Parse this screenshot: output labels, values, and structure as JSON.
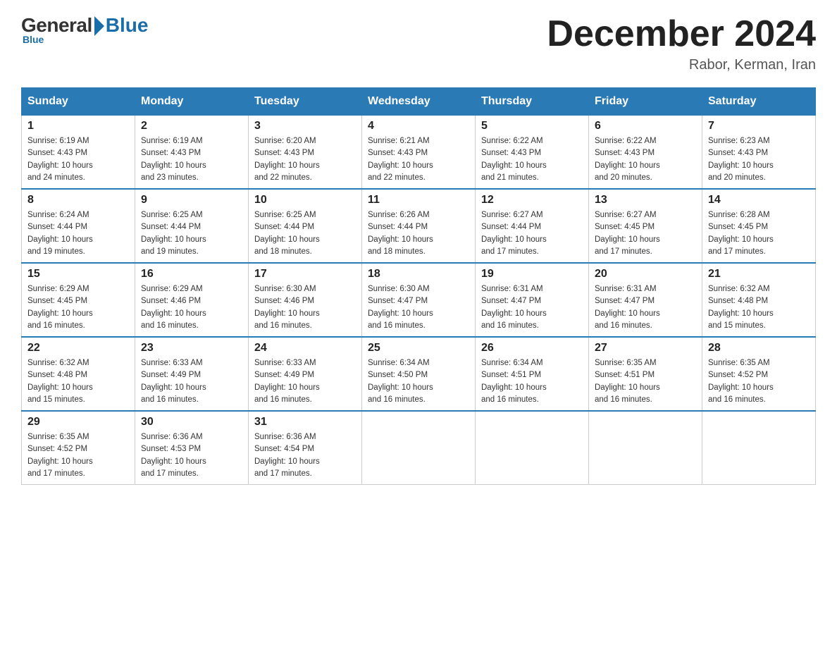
{
  "header": {
    "logo_general": "General",
    "logo_blue": "Blue",
    "month_year": "December 2024",
    "location": "Rabor, Kerman, Iran"
  },
  "days_of_week": [
    "Sunday",
    "Monday",
    "Tuesday",
    "Wednesday",
    "Thursday",
    "Friday",
    "Saturday"
  ],
  "weeks": [
    [
      {
        "day": "1",
        "sunrise": "6:19 AM",
        "sunset": "4:43 PM",
        "daylight": "10 hours and 24 minutes."
      },
      {
        "day": "2",
        "sunrise": "6:19 AM",
        "sunset": "4:43 PM",
        "daylight": "10 hours and 23 minutes."
      },
      {
        "day": "3",
        "sunrise": "6:20 AM",
        "sunset": "4:43 PM",
        "daylight": "10 hours and 22 minutes."
      },
      {
        "day": "4",
        "sunrise": "6:21 AM",
        "sunset": "4:43 PM",
        "daylight": "10 hours and 22 minutes."
      },
      {
        "day": "5",
        "sunrise": "6:22 AM",
        "sunset": "4:43 PM",
        "daylight": "10 hours and 21 minutes."
      },
      {
        "day": "6",
        "sunrise": "6:22 AM",
        "sunset": "4:43 PM",
        "daylight": "10 hours and 20 minutes."
      },
      {
        "day": "7",
        "sunrise": "6:23 AM",
        "sunset": "4:43 PM",
        "daylight": "10 hours and 20 minutes."
      }
    ],
    [
      {
        "day": "8",
        "sunrise": "6:24 AM",
        "sunset": "4:44 PM",
        "daylight": "10 hours and 19 minutes."
      },
      {
        "day": "9",
        "sunrise": "6:25 AM",
        "sunset": "4:44 PM",
        "daylight": "10 hours and 19 minutes."
      },
      {
        "day": "10",
        "sunrise": "6:25 AM",
        "sunset": "4:44 PM",
        "daylight": "10 hours and 18 minutes."
      },
      {
        "day": "11",
        "sunrise": "6:26 AM",
        "sunset": "4:44 PM",
        "daylight": "10 hours and 18 minutes."
      },
      {
        "day": "12",
        "sunrise": "6:27 AM",
        "sunset": "4:44 PM",
        "daylight": "10 hours and 17 minutes."
      },
      {
        "day": "13",
        "sunrise": "6:27 AM",
        "sunset": "4:45 PM",
        "daylight": "10 hours and 17 minutes."
      },
      {
        "day": "14",
        "sunrise": "6:28 AM",
        "sunset": "4:45 PM",
        "daylight": "10 hours and 17 minutes."
      }
    ],
    [
      {
        "day": "15",
        "sunrise": "6:29 AM",
        "sunset": "4:45 PM",
        "daylight": "10 hours and 16 minutes."
      },
      {
        "day": "16",
        "sunrise": "6:29 AM",
        "sunset": "4:46 PM",
        "daylight": "10 hours and 16 minutes."
      },
      {
        "day": "17",
        "sunrise": "6:30 AM",
        "sunset": "4:46 PM",
        "daylight": "10 hours and 16 minutes."
      },
      {
        "day": "18",
        "sunrise": "6:30 AM",
        "sunset": "4:47 PM",
        "daylight": "10 hours and 16 minutes."
      },
      {
        "day": "19",
        "sunrise": "6:31 AM",
        "sunset": "4:47 PM",
        "daylight": "10 hours and 16 minutes."
      },
      {
        "day": "20",
        "sunrise": "6:31 AM",
        "sunset": "4:47 PM",
        "daylight": "10 hours and 16 minutes."
      },
      {
        "day": "21",
        "sunrise": "6:32 AM",
        "sunset": "4:48 PM",
        "daylight": "10 hours and 15 minutes."
      }
    ],
    [
      {
        "day": "22",
        "sunrise": "6:32 AM",
        "sunset": "4:48 PM",
        "daylight": "10 hours and 15 minutes."
      },
      {
        "day": "23",
        "sunrise": "6:33 AM",
        "sunset": "4:49 PM",
        "daylight": "10 hours and 16 minutes."
      },
      {
        "day": "24",
        "sunrise": "6:33 AM",
        "sunset": "4:49 PM",
        "daylight": "10 hours and 16 minutes."
      },
      {
        "day": "25",
        "sunrise": "6:34 AM",
        "sunset": "4:50 PM",
        "daylight": "10 hours and 16 minutes."
      },
      {
        "day": "26",
        "sunrise": "6:34 AM",
        "sunset": "4:51 PM",
        "daylight": "10 hours and 16 minutes."
      },
      {
        "day": "27",
        "sunrise": "6:35 AM",
        "sunset": "4:51 PM",
        "daylight": "10 hours and 16 minutes."
      },
      {
        "day": "28",
        "sunrise": "6:35 AM",
        "sunset": "4:52 PM",
        "daylight": "10 hours and 16 minutes."
      }
    ],
    [
      {
        "day": "29",
        "sunrise": "6:35 AM",
        "sunset": "4:52 PM",
        "daylight": "10 hours and 17 minutes."
      },
      {
        "day": "30",
        "sunrise": "6:36 AM",
        "sunset": "4:53 PM",
        "daylight": "10 hours and 17 minutes."
      },
      {
        "day": "31",
        "sunrise": "6:36 AM",
        "sunset": "4:54 PM",
        "daylight": "10 hours and 17 minutes."
      },
      null,
      null,
      null,
      null
    ]
  ],
  "labels": {
    "sunrise": "Sunrise:",
    "sunset": "Sunset:",
    "daylight": "Daylight:"
  }
}
